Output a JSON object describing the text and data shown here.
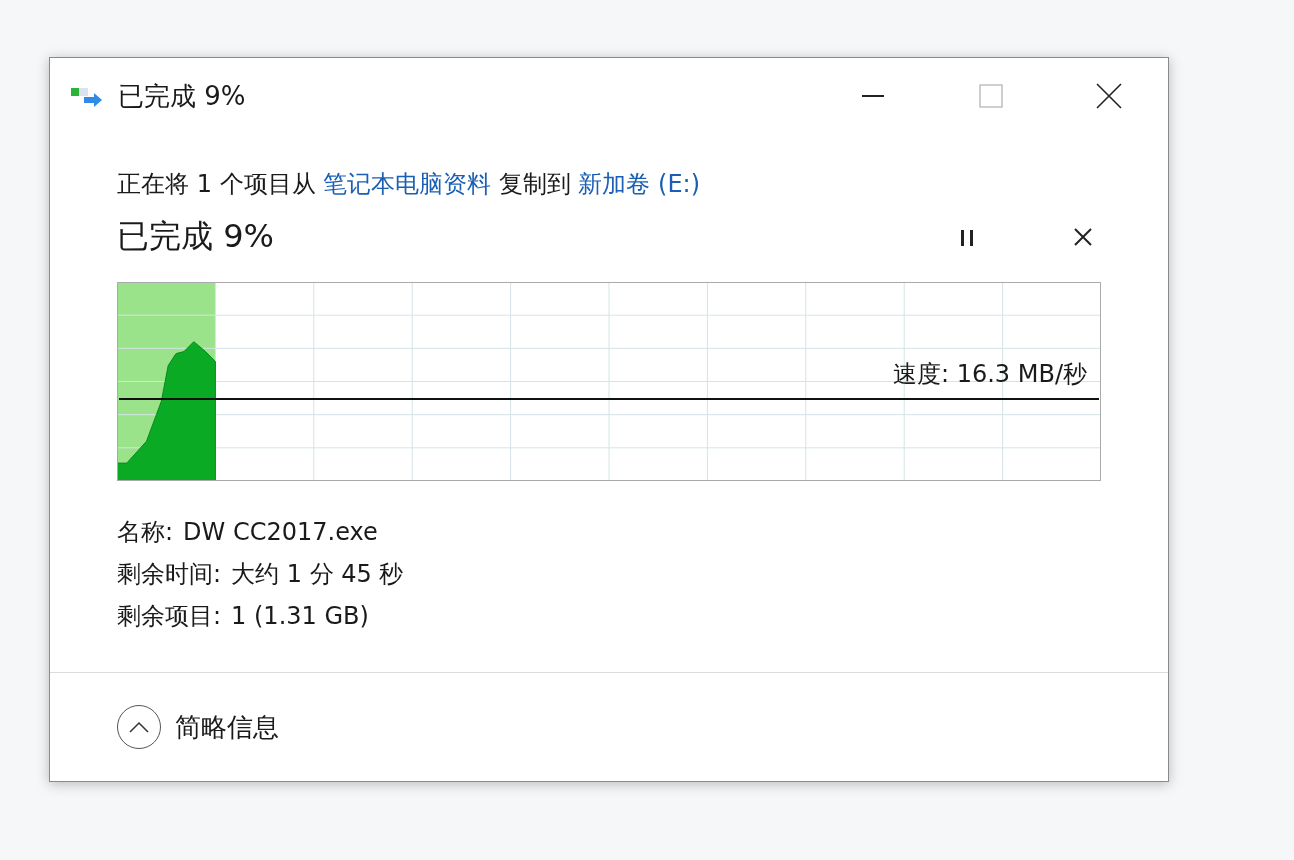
{
  "window": {
    "title": "已完成 9%"
  },
  "description": {
    "prefix": "正在将 1 个项目从 ",
    "source": "笔记本电脑资料",
    "middle": " 复制到 ",
    "destination": "新加卷 (E:)"
  },
  "status": "已完成 9%",
  "progress": {
    "level": 0.1,
    "speed": "速度: 16.3 MB/秒"
  },
  "details": [
    {
      "label": "名称:",
      "value": "DW CC2017.exe"
    },
    {
      "label": "剩余时间:",
      "value": "大约 1 分 45 秒"
    },
    {
      "label": "剩余项目:",
      "value": "1 (1.31 GB)"
    }
  ],
  "footer": {
    "toggle": "简略信息",
    "expanded": true
  }
}
